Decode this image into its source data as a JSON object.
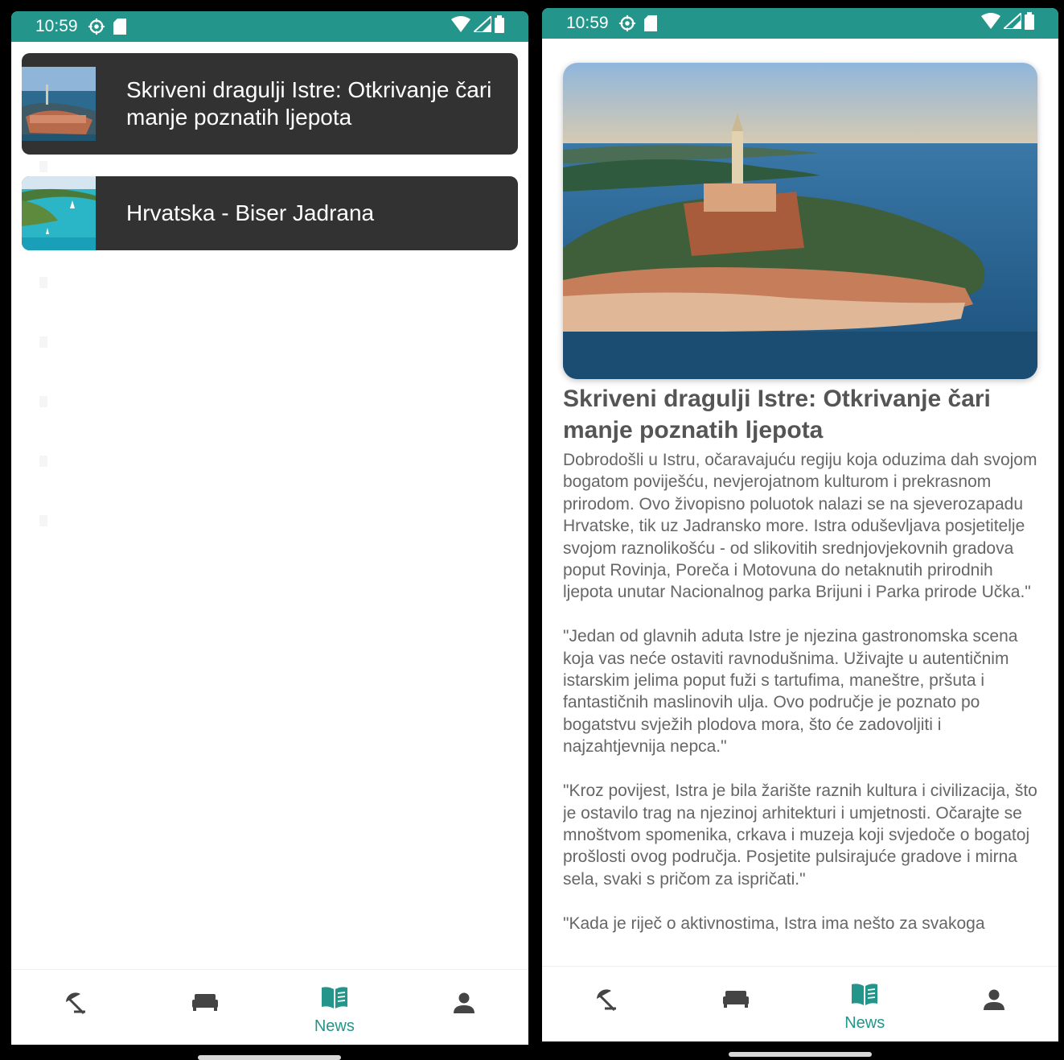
{
  "status": {
    "time": "10:59"
  },
  "news_list": {
    "items": [
      {
        "title": "Skriveni dragulji Istre: Otkrivanje čari manje poznatih ljepota"
      },
      {
        "title": "Hrvatska - Biser Jadrana"
      }
    ]
  },
  "nav": {
    "items": [
      {
        "icon": "beach-umbrella-icon",
        "label": ""
      },
      {
        "icon": "bed-icon",
        "label": ""
      },
      {
        "icon": "news-book-icon",
        "label": "News"
      },
      {
        "icon": "person-icon",
        "label": ""
      }
    ],
    "active_index": 2,
    "active_color": "#23958a"
  },
  "article": {
    "title": "Skriveni dragulji Istre: Otkrivanje čari manje poznatih ljepota",
    "body": "Dobrodošli u Istru, očaravajuću regiju koja oduzima dah svojom bogatom poviješću, nevjerojatnom kulturom i prekrasnom prirodom. Ovo živopisno poluotok nalazi se na sjeverozapadu Hrvatske, tik uz Jadransko more. Istra oduševljava posjetitelje svojom raznolikošću - od slikovitih srednjovjekovnih gradova poput Rovinja, Poreča i Motovuna do netaknutih prirodnih ljepota unutar Nacionalnog parka Brijuni i Parka prirode Učka.\"\n\n\"Jedan od glavnih aduta Istre je njezina gastronomska scena koja vas neće ostaviti ravnodušnima. Uživajte u autentičnim istarskim jelima poput fuži s tartufima, maneštre, pršuta i fantastičnih maslinovih ulja. Ovo područje je poznato po bogatstvu svježih plodova mora, što će zadovoljiti i najzahtjevnija nepca.\"\n\n\"Kroz povijest, Istra je bila žarište raznih kultura i civilizacija, što je ostavilo trag na njezinoj arhitekturi i umjetnosti. Očarajte se mnoštvom spomenika, crkava i muzeja koji svjedoče o bogatoj prošlosti ovog područja. Posjetite pulsirajuće gradove i mirna sela, svaki s pričom za ispričati.\"\n\n\"Kada je riječ o aktivnostima, Istra ima nešto za svakoga"
  },
  "colors": {
    "status_bar": "#23958a",
    "card": "#323232"
  }
}
